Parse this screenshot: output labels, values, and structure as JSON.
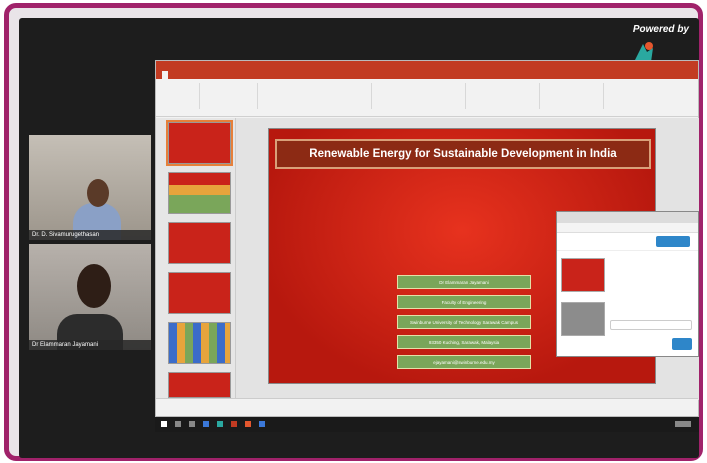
{
  "branding": {
    "powered_by": "Powered by"
  },
  "participants": [
    {
      "name": "Dr. D. Sivamurugethasan"
    },
    {
      "name": "Dr Elammaran Jayamani"
    }
  ],
  "slide": {
    "title": "Renewable Energy for Sustainable Development in India",
    "info_lines": [
      "Dr Elammaran Jayamani",
      "Faculty of Engineering",
      "Swinburne University of Technology Sarawak Campus",
      "93350 Kuching, Sarawak, Malaysia",
      "ejayamani@swinburne.edu.my"
    ]
  },
  "colors": {
    "frame_border": "#a0226a",
    "ppt_accent": "#c23b22",
    "slide_red": "#d42a1a",
    "info_box_green": "#7aa65a",
    "streamyard_blue": "#2e86c9"
  }
}
